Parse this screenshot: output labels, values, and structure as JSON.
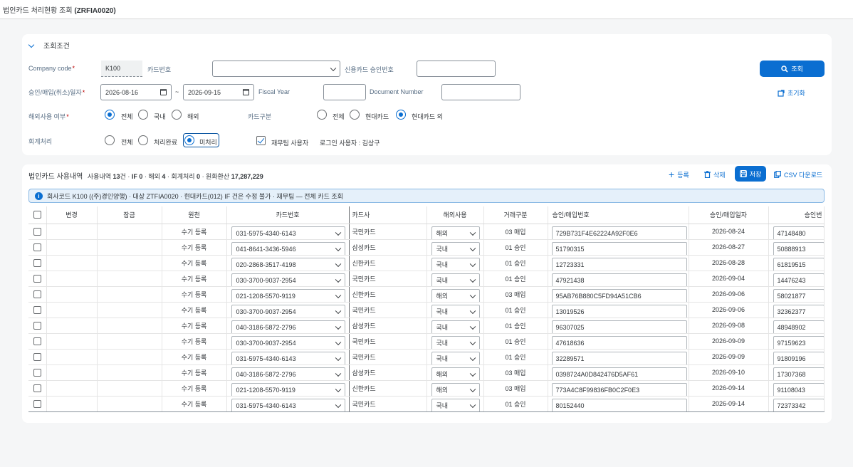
{
  "app": {
    "title_prefix": "법인카드 처리현황 조회",
    "title_code": "(ZRFIA0020)"
  },
  "filter": {
    "section_title": "조회조건",
    "company_code": {
      "label": "Company code",
      "value": "K100"
    },
    "card_no": {
      "label": "카드번호",
      "value": ""
    },
    "approval_no": {
      "label": "신용카드 승인번호",
      "value": ""
    },
    "date": {
      "label": "승인/매입(취소)일자",
      "from": "2026-08-16",
      "sep": "~",
      "to": "2026-09-15"
    },
    "fiscal_year": {
      "label": "Fiscal Year",
      "value": ""
    },
    "document_number": {
      "label": "Document Number",
      "value": ""
    },
    "overseas": {
      "label": "해외사용 여부",
      "options": [
        "전체",
        "국내",
        "해외"
      ],
      "selected": "전체"
    },
    "card_type": {
      "label": "카드구분",
      "options": [
        "전체",
        "현대카드",
        "현대카드 외"
      ],
      "selected": "현대카드 외"
    },
    "accounting": {
      "label": "회계처리",
      "options": [
        "전체",
        "처리완료",
        "미처리"
      ],
      "selected": "미처리"
    },
    "finance_user": {
      "label": "재무팀 사용자",
      "checked": true
    },
    "login_user": "로그인 사용자 : 김상구",
    "search_button": "조회",
    "reset_button": "초기화"
  },
  "results": {
    "title": "법인카드 사용내역",
    "summary": [
      {
        "t": "사용내역 "
      },
      {
        "t": "13",
        "b": true
      },
      {
        "t": "건 · "
      },
      {
        "t": "IF 0",
        "b": true
      },
      {
        "t": " · 해외 "
      },
      {
        "t": "4",
        "b": true
      },
      {
        "t": " · 회계처리 "
      },
      {
        "t": "0",
        "b": true
      },
      {
        "t": " · 원화환산 "
      },
      {
        "t": "17,287,229",
        "b": true
      }
    ],
    "toolbar": {
      "add": "등록",
      "delete": "삭제",
      "save": "저장",
      "csv": "CSV 다운로드"
    },
    "info_text": "회사코드 K100 ((주)경인양행) · 대상 ZTFIA0020 · 현대카드(012) IF 건은 수정 불가 · 재무팀 — 전체 카드 조회",
    "columns": [
      "",
      "변경",
      "잠금",
      "원천",
      "카드번호",
      "카드사",
      "해외사용",
      "거래구분",
      "승인/매입번호",
      "승인/매입일자",
      "승인번"
    ],
    "rows": [
      {
        "source": "수기 등록",
        "card": "031-5975-4340-6143",
        "company": "국민카드",
        "overseas": "해외",
        "type": "03 매입",
        "doc": "729B731F4E62224A92F0E6",
        "date": "2026-08-24",
        "appr": "47148480"
      },
      {
        "source": "수기 등록",
        "card": "041-8641-3436-5946",
        "company": "삼성카드",
        "overseas": "국내",
        "type": "01 승인",
        "doc": "51790315",
        "date": "2026-08-27",
        "appr": "50888913"
      },
      {
        "source": "수기 등록",
        "card": "020-2868-3517-4198",
        "company": "신한카드",
        "overseas": "국내",
        "type": "01 승인",
        "doc": "12723331",
        "date": "2026-08-28",
        "appr": "61819515"
      },
      {
        "source": "수기 등록",
        "card": "030-3700-9037-2954",
        "company": "국민카드",
        "overseas": "국내",
        "type": "01 승인",
        "doc": "47921438",
        "date": "2026-09-04",
        "appr": "14476243"
      },
      {
        "source": "수기 등록",
        "card": "021-1208-5570-9119",
        "company": "신한카드",
        "overseas": "해외",
        "type": "03 매입",
        "doc": "95AB76B880C5FD94A51CB6",
        "date": "2026-09-06",
        "appr": "58021877"
      },
      {
        "source": "수기 등록",
        "card": "030-3700-9037-2954",
        "company": "국민카드",
        "overseas": "국내",
        "type": "01 승인",
        "doc": "13019526",
        "date": "2026-09-06",
        "appr": "32362377"
      },
      {
        "source": "수기 등록",
        "card": "040-3186-5872-2796",
        "company": "삼성카드",
        "overseas": "국내",
        "type": "01 승인",
        "doc": "96307025",
        "date": "2026-09-08",
        "appr": "48948902"
      },
      {
        "source": "수기 등록",
        "card": "030-3700-9037-2954",
        "company": "국민카드",
        "overseas": "국내",
        "type": "01 승인",
        "doc": "47618636",
        "date": "2026-09-09",
        "appr": "97159623"
      },
      {
        "source": "수기 등록",
        "card": "031-5975-4340-6143",
        "company": "국민카드",
        "overseas": "국내",
        "type": "01 승인",
        "doc": "32289571",
        "date": "2026-09-09",
        "appr": "91809196"
      },
      {
        "source": "수기 등록",
        "card": "040-3186-5872-2796",
        "company": "삼성카드",
        "overseas": "해외",
        "type": "03 매입",
        "doc": "0398724A0D842476D5AF61",
        "date": "2026-09-10",
        "appr": "17307368"
      },
      {
        "source": "수기 등록",
        "card": "021-1208-5570-9119",
        "company": "신한카드",
        "overseas": "해외",
        "type": "03 매입",
        "doc": "773A4C8F99836FB0C2F0E3",
        "date": "2026-09-14",
        "appr": "91108043"
      },
      {
        "source": "수기 등록",
        "card": "031-5975-4340-6143",
        "company": "국민카드",
        "overseas": "국내",
        "type": "01 승인",
        "doc": "80152440",
        "date": "2026-09-14",
        "appr": "72373342"
      }
    ]
  },
  "colors": {
    "accent": "#0a6ed1",
    "required": "#bb0000",
    "info_bg": "#e5f0fa"
  }
}
